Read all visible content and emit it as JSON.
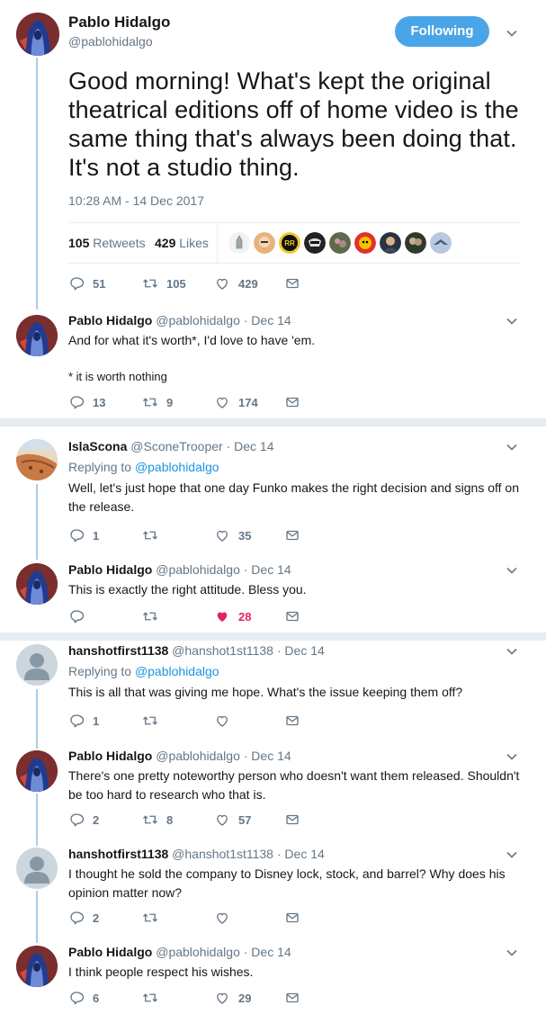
{
  "main": {
    "name": "Pablo Hidalgo",
    "handle": "@pablohidalgo",
    "follow_label": "Following",
    "text": "Good morning! What's kept the original theatrical editions off of home video is the same thing that's always been doing that. It's not a studio thing.",
    "timestamp": "10:28 AM - 14 Dec 2017",
    "retweets_count": "105",
    "retweets_label": "Retweets",
    "likes_count": "429",
    "likes_label": "Likes",
    "actions": {
      "replies": "51",
      "retweets": "105",
      "likes": "429"
    }
  },
  "replies": [
    {
      "name": "Pablo Hidalgo",
      "handle": "@pablohidalgo",
      "date": "· Dec 14",
      "text": "And for what it's worth*, I'd love to have 'em.",
      "text2": "* it is worth nothing",
      "replies": "13",
      "retweets": "9",
      "likes": "174"
    },
    {
      "name": "IslaScona",
      "handle": "@SconeTrooper",
      "date": "· Dec 14",
      "replying_prefix": "Replying to",
      "replying_to": "@pablohidalgo",
      "text": "Well, let's just hope that one day Funko makes the right decision and signs off on the release.",
      "replies": "1",
      "retweets": "",
      "likes": "35"
    },
    {
      "name": "Pablo Hidalgo",
      "handle": "@pablohidalgo",
      "date": "· Dec 14",
      "text": "This is exactly the right attitude. Bless you.",
      "replies": "",
      "retweets": "",
      "likes": "28"
    },
    {
      "name": "hanshotfirst1138",
      "handle": "@hanshot1st1138",
      "date": "· Dec 14",
      "replying_prefix": "Replying to",
      "replying_to": "@pablohidalgo",
      "text": "This is all that was giving me hope. What's the issue keeping them off?",
      "replies": "1",
      "retweets": "",
      "likes": ""
    },
    {
      "name": "Pablo Hidalgo",
      "handle": "@pablohidalgo",
      "date": "· Dec 14",
      "text": "There's one pretty noteworthy person who doesn't want them released. Shouldn't be too hard to research who that is.",
      "replies": "2",
      "retweets": "8",
      "likes": "57"
    },
    {
      "name": "hanshotfirst1138",
      "handle": "@hanshot1st1138",
      "date": "· Dec 14",
      "text": "I thought he sold the company to Disney lock, stock, and barrel? Why does his opinion matter now?",
      "replies": "2",
      "retweets": "",
      "likes": ""
    },
    {
      "name": "Pablo Hidalgo",
      "handle": "@pablohidalgo",
      "date": "· Dec 14",
      "text": "I think people respect his wishes.",
      "replies": "6",
      "retweets": "",
      "likes": "29"
    }
  ],
  "icons": {
    "reply": "reply-icon",
    "retweet": "retweet-icon",
    "like": "heart-icon",
    "dm": "envelope-icon",
    "caret": "chevron-down-icon"
  },
  "colors": {
    "accent": "#1da1f2",
    "follow_button": "#4aa5e8",
    "liked": "#e0245e",
    "thread_line": "#a9cde8",
    "muted": "#657786"
  }
}
